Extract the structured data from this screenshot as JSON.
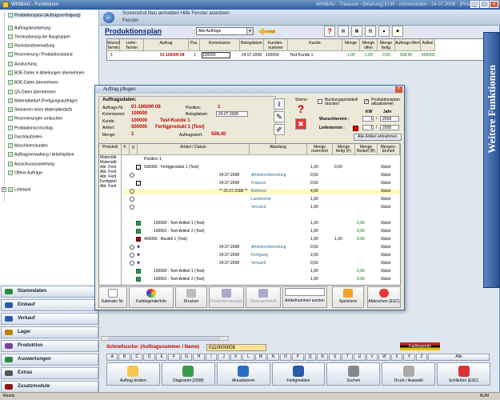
{
  "window": {
    "icon_label": "",
    "title_left": "WINBAU - Funktionen",
    "menu": [
      "Screenshot",
      "Neu anmelden",
      "Hilfe",
      "Fenster anordnen"
    ],
    "app_title": "WINBAU - Treasure - [Wartung] EUR - Administrator - 24.07.2008 - [Produktionsplan]"
  },
  "addressbar": {
    "path": "Screenshot  Neu anmelden  Hilfe  Fenster anordnen",
    "fenster": "Fenster"
  },
  "sidebar": {
    "items": [
      "Produktionsplan (Auftragsverfolgung)",
      "Auftragsbearbeitung",
      "Terminplanung der Baugruppen",
      "Rückstandsverwaltung",
      "Reservierung / Produktionsstand",
      "Ausbuchung",
      "BDE-Daten in Abteilungen übernehmen",
      "BDE-Daten übernehmen",
      "QS-Daten übernehmen",
      "Materialbedarf (Fertigungsaufträge)",
      "Stornieren eines Materialbedarfs",
      "Reservierungen umbuchen",
      "Produktionsvorschlag",
      "Durchlaufzeiten",
      "Maschinenstunden",
      "Auftragsverwaltung / Arbeitspläne",
      "Ausschussauswertung",
      "Offene Aufträge",
      "Leitstand"
    ]
  },
  "nav": {
    "items": [
      "Stammdaten",
      "Einkauf",
      "Verkauf",
      "Lager",
      "Produktion",
      "Auswertungen",
      "Extras",
      "Zusatzmodule"
    ],
    "colors": [
      "#2e8b3e",
      "#2b5aa8",
      "#2b5aa8",
      "#b8860b",
      "#7a3fa0",
      "#2e8b3e",
      "#555555",
      "#8b1a1a"
    ]
  },
  "prodplan": {
    "title": "Produktionsplan",
    "filter": "Alle Aufträge",
    "headers": [
      "Wunsch-Termin",
      "Liefer-Termin",
      "Auftrag",
      "Pos.",
      "Kommission",
      "Belegdatum",
      "Kunden-nummer",
      "Kunde",
      "Menge",
      "Menge offen",
      "Menge fertig",
      "Auftrags-Wert",
      "Artikel"
    ],
    "row": {
      "nr": "1",
      "auftrag": "01 100000 08",
      "pos": "1",
      "kommission": "100000",
      "belegdatum": "24.07.2008",
      "kundennr": "100000",
      "kunde": "Test-Kunde 1",
      "menge": "1,00",
      "offen": "1,00",
      "fertig": "0,00",
      "wert": "508,40",
      "artikel": "500000"
    }
  },
  "weitere": "Weitere Funktionen",
  "dialog": {
    "title": "Auftrag pflegen",
    "section": "Auftragsdaten:",
    "labels": {
      "auftragsnr": "Auftrags-Nr.",
      "position": "Position:",
      "kommission": "Kommission:",
      "belegdatum": "Belegdatum:",
      "kunde": "Kunde:",
      "artikel": "Artikel:",
      "menge": "Menge:",
      "auftragswert": "Auftragswert:"
    },
    "values": {
      "auftragsnr": "01 100000 08",
      "position": "1",
      "kommission": "100000",
      "belegdatum": "24.07.2008",
      "kundennr": "100000",
      "kunde": "Test-Kunde 1",
      "artikelnr": "500000",
      "artikel": "Fertigprodukt 1 (Test)",
      "menge": "1",
      "auftragswert": "508,40"
    },
    "storno": "Storno",
    "buchung_label": "Buchungsprotokoll drucken",
    "prodplan_label": "Produktionsplan aktualisieren",
    "kw": "KW",
    "jahr": "Jahr",
    "wunschtermin_label": "Wunschtermin :",
    "wunschtermin_kw": "1",
    "wunschtermin_jahr": "2008",
    "liefertermin_label": "Liefertermin :",
    "liefertermin_kw": "1",
    "liefertermin_jahr": "2008",
    "alle_artikel": "Alle Artikel entnehmen",
    "grid_headers": [
      "Protokoll",
      "F.",
      "g",
      "Artikel / Datum",
      "Abteilung",
      "Menge reserviert",
      "Menge fertig (F)",
      "Menge Bedarf (B)",
      "Mengen-Einheit"
    ],
    "protokoll": [
      "Materialb",
      "Materialb",
      "Abt. Ferti",
      "Abt. Ferti",
      "Abt. Ferti",
      "Fertigstel",
      "Abt. Ferti"
    ],
    "rows": [
      {
        "artikel": "Position 1",
        "abteilung": "",
        "res": "",
        "fertig": "",
        "bedarf": "",
        "einheit": ""
      },
      {
        "artikel": "500000 : Fertigprodukt 1 (Test)",
        "abteilung": "",
        "res": "1,00",
        "fertig": "0,00",
        "bedarf": "",
        "einheit": "Stück"
      },
      {
        "artikel": "24.07.2008",
        "abteilung": "Arbeitsvorbereitung",
        "res": "0,50",
        "fertig": "",
        "bedarf": "",
        "einheit": "Stück"
      },
      {
        "artikel": "24.07.2008",
        "abteilung": "Fräserei",
        "res": "0,50",
        "fertig": "",
        "bedarf": "",
        "einheit": "Stück"
      },
      {
        "artikel": "** 25.07.2008 **",
        "abteilung": "Bohrerei",
        "res": "4,00",
        "fertig": "",
        "bedarf": "",
        "einheit": "Stück"
      },
      {
        "artikel": "",
        "abteilung": "Lackiererei",
        "res": "1,00",
        "fertig": "",
        "bedarf": "",
        "einheit": "Stück"
      },
      {
        "artikel": "",
        "abteilung": "Versand",
        "res": "1,00",
        "fertig": "",
        "bedarf": "",
        "einheit": "Stück"
      },
      {
        "artikel": "",
        "abteilung": "",
        "res": "",
        "fertig": "",
        "bedarf": "",
        "einheit": ""
      },
      {
        "artikel": "100000 : Test-Artikel 1 (Test)",
        "abteilung": "",
        "res": "1,00",
        "fertig": "",
        "bedarf": "0,00",
        "einheit": "Stück"
      },
      {
        "artikel": "100001 : Test-Artikel 2 (Test)",
        "abteilung": "",
        "res": "1,00",
        "fertig": "",
        "bedarf": "0,00",
        "einheit": "Stück"
      },
      {
        "artikel": "400000 : Bauteil 1 (Test)",
        "abteilung": "",
        "res": "1,00",
        "fertig": "1,00",
        "bedarf": "0,00",
        "einheit": "Stück"
      },
      {
        "artikel": "24.07.2008",
        "abteilung": "Arbeitsvorbereitung",
        "res": "0,50",
        "fertig": "",
        "bedarf": "",
        "einheit": "Stück"
      },
      {
        "artikel": "24.07.2008",
        "abteilung": "Fertigung",
        "res": "2,00",
        "fertig": "",
        "bedarf": "",
        "einheit": "Stück"
      },
      {
        "artikel": "24.07.2008",
        "abteilung": "Versand",
        "res": "0,50",
        "fertig": "",
        "bedarf": "",
        "einheit": "Stück"
      },
      {
        "artikel": "100000 : Test-Artikel 1 (Test)",
        "abteilung": "",
        "res": "1,00",
        "fertig": "",
        "bedarf": "0,00",
        "einheit": "Stück"
      },
      {
        "artikel": "100001 : Test-Artikel 2 (Test)",
        "abteilung": "",
        "res": "1,00",
        "fertig": "",
        "bedarf": "0,00",
        "einheit": "Stück"
      }
    ],
    "footer": {
      "kalender": "Kalender Nr.",
      "farb": "Farblegende/Info",
      "drucken": "Drucken",
      "produktionsbogen": "Produktionsbogen",
      "statusprotokoll": "Statusprotokoll",
      "artikelsuchen": "Artikelnummer suchen",
      "speichern": "Speichern",
      "abbrechen": "Abbrechen (ESC)"
    }
  },
  "schnellsuche": {
    "label": "Schnellsuche: (Auftragsnummer / Name)",
    "value": "0110000008",
    "farblegende": "Farblegende"
  },
  "alphabet": [
    "A",
    "B",
    "C",
    "D",
    "E",
    "F",
    "G",
    "H",
    "I",
    "J",
    "K",
    "L",
    "M",
    "N",
    "O",
    "P",
    "Q",
    "R",
    "S",
    "T",
    "U",
    "V",
    "W",
    "X",
    "Y",
    "Z",
    "Alle"
  ],
  "bottom_buttons": [
    "Auftrag ändern",
    "Diagramm [2008]",
    "Aktualisieren",
    "Fertigmelden",
    "Suchen",
    "Druck / Auswahl",
    "Schließen (ESC)"
  ],
  "status": {
    "left": "Ready",
    "right": "NUM"
  }
}
